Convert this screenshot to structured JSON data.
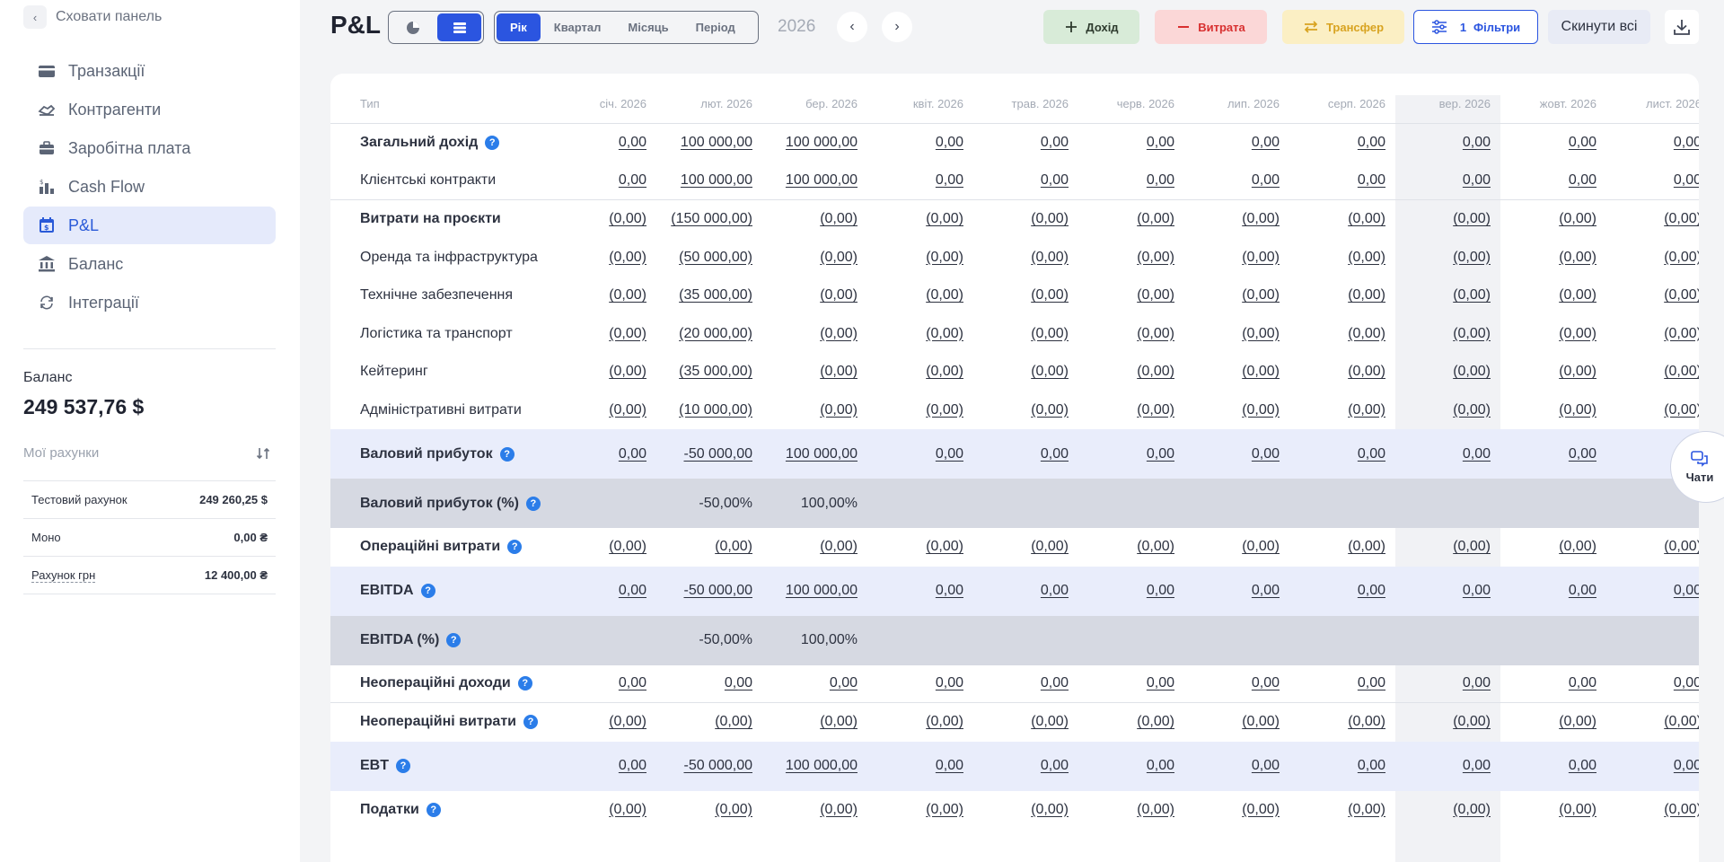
{
  "sidebar": {
    "collapse_label": "Сховати панель",
    "items": [
      {
        "label": "Транзакції",
        "icon": "card-icon"
      },
      {
        "label": "Контрагенти",
        "icon": "handshake-icon"
      },
      {
        "label": "Заробітна плата",
        "icon": "briefcase-icon"
      },
      {
        "label": "Cash Flow",
        "icon": "cashflow-icon"
      },
      {
        "label": "P&L",
        "icon": "calendar-dollar-icon",
        "active": true
      },
      {
        "label": "Баланс",
        "icon": "bank-icon"
      },
      {
        "label": "Інтеграції",
        "icon": "sync-icon"
      }
    ],
    "balance_label": "Баланс",
    "balance_value": "249 537,76 $",
    "accounts_label": "Мої рахунки",
    "accounts": [
      {
        "name": "Тестовий рахунок",
        "amount": "249 260,25 $"
      },
      {
        "name": "Моно",
        "amount": "0,00 ₴"
      },
      {
        "name": "Рахунок грн",
        "amount": "12 400,00 ₴"
      }
    ]
  },
  "toolbar": {
    "title": "P&L",
    "period_tabs": [
      "Рік",
      "Квартал",
      "Місяць",
      "Період"
    ],
    "active_period": "Рік",
    "year": "2026",
    "income_label": "Дохід",
    "expense_label": "Витрата",
    "transfer_label": "Трансфер",
    "filters_count": "1",
    "filters_label": "Фільтри",
    "reset_label": "Скинути всі"
  },
  "table": {
    "type_header": "Тип",
    "months": [
      "січ. 2026",
      "лют. 2026",
      "бер. 2026",
      "квіт. 2026",
      "трав. 2026",
      "черв. 2026",
      "лип. 2026",
      "серп. 2026",
      "вер. 2026",
      "жовт. 2026",
      "лист. 2026"
    ],
    "rows": [
      {
        "label": "Загальний дохід",
        "bold": true,
        "help": true,
        "values": [
          "0,00",
          "100 000,00",
          "100 000,00",
          "0,00",
          "0,00",
          "0,00",
          "0,00",
          "0,00",
          "0,00",
          "0,00",
          "0,00"
        ]
      },
      {
        "label": "Клієнтські контракти",
        "values": [
          "0,00",
          "100 000,00",
          "100 000,00",
          "0,00",
          "0,00",
          "0,00",
          "0,00",
          "0,00",
          "0,00",
          "0,00",
          "0,00"
        ],
        "line": true
      },
      {
        "label": "Витрати на проєкти",
        "bold": true,
        "values": [
          "(0,00)",
          "(150 000,00)",
          "(0,00)",
          "(0,00)",
          "(0,00)",
          "(0,00)",
          "(0,00)",
          "(0,00)",
          "(0,00)",
          "(0,00)",
          "(0,00)"
        ]
      },
      {
        "label": "Оренда та інфраструктура",
        "values": [
          "(0,00)",
          "(50 000,00)",
          "(0,00)",
          "(0,00)",
          "(0,00)",
          "(0,00)",
          "(0,00)",
          "(0,00)",
          "(0,00)",
          "(0,00)",
          "(0,00)"
        ]
      },
      {
        "label": "Технічне забезпечення",
        "values": [
          "(0,00)",
          "(35 000,00)",
          "(0,00)",
          "(0,00)",
          "(0,00)",
          "(0,00)",
          "(0,00)",
          "(0,00)",
          "(0,00)",
          "(0,00)",
          "(0,00)"
        ]
      },
      {
        "label": "Логістика та транспорт",
        "values": [
          "(0,00)",
          "(20 000,00)",
          "(0,00)",
          "(0,00)",
          "(0,00)",
          "(0,00)",
          "(0,00)",
          "(0,00)",
          "(0,00)",
          "(0,00)",
          "(0,00)"
        ]
      },
      {
        "label": "Кейтеринг",
        "values": [
          "(0,00)",
          "(35 000,00)",
          "(0,00)",
          "(0,00)",
          "(0,00)",
          "(0,00)",
          "(0,00)",
          "(0,00)",
          "(0,00)",
          "(0,00)",
          "(0,00)"
        ]
      },
      {
        "label": "Адміністративні витрати",
        "values": [
          "(0,00)",
          "(10 000,00)",
          "(0,00)",
          "(0,00)",
          "(0,00)",
          "(0,00)",
          "(0,00)",
          "(0,00)",
          "(0,00)",
          "(0,00)",
          "(0,00)"
        ]
      },
      {
        "label": "Валовий прибуток",
        "bold": true,
        "help": true,
        "shade": "blue",
        "values": [
          "0,00",
          "-50 000,00",
          "100 000,00",
          "0,00",
          "0,00",
          "0,00",
          "0,00",
          "0,00",
          "0,00",
          "0,00",
          ""
        ]
      },
      {
        "label": "Валовий прибуток (%)",
        "bold": true,
        "help": true,
        "shade": "gray",
        "plain": true,
        "values": [
          "",
          "-50,00%",
          "100,00%",
          "",
          "",
          "",
          "",
          "",
          "",
          "",
          ""
        ]
      },
      {
        "label": "Операційні витрати",
        "bold": true,
        "help": true,
        "values": [
          "(0,00)",
          "(0,00)",
          "(0,00)",
          "(0,00)",
          "(0,00)",
          "(0,00)",
          "(0,00)",
          "(0,00)",
          "(0,00)",
          "(0,00)",
          "(0,00)"
        ]
      },
      {
        "label": "EBITDA",
        "bold": true,
        "help": true,
        "shade": "blue",
        "values": [
          "0,00",
          "-50 000,00",
          "100 000,00",
          "0,00",
          "0,00",
          "0,00",
          "0,00",
          "0,00",
          "0,00",
          "0,00",
          "0,00"
        ]
      },
      {
        "label": "EBITDA (%)",
        "bold": true,
        "help": true,
        "shade": "gray",
        "plain": true,
        "values": [
          "",
          "-50,00%",
          "100,00%",
          "",
          "",
          "",
          "",
          "",
          "",
          "",
          ""
        ]
      },
      {
        "label": "Неопераційні доходи",
        "bold": true,
        "help": true,
        "values": [
          "0,00",
          "0,00",
          "0,00",
          "0,00",
          "0,00",
          "0,00",
          "0,00",
          "0,00",
          "0,00",
          "0,00",
          "0,00"
        ],
        "line": true
      },
      {
        "label": "Неопераційні витрати",
        "bold": true,
        "help": true,
        "values": [
          "(0,00)",
          "(0,00)",
          "(0,00)",
          "(0,00)",
          "(0,00)",
          "(0,00)",
          "(0,00)",
          "(0,00)",
          "(0,00)",
          "(0,00)",
          "(0,00)"
        ]
      },
      {
        "label": "EBT",
        "bold": true,
        "help": true,
        "shade": "blue",
        "values": [
          "0,00",
          "-50 000,00",
          "100 000,00",
          "0,00",
          "0,00",
          "0,00",
          "0,00",
          "0,00",
          "0,00",
          "0,00",
          "0,00"
        ]
      },
      {
        "label": "Податки",
        "bold": true,
        "help": true,
        "values": [
          "(0,00)",
          "(0,00)",
          "(0,00)",
          "(0,00)",
          "(0,00)",
          "(0,00)",
          "(0,00)",
          "(0,00)",
          "(0,00)",
          "(0,00)",
          "(0,00)"
        ]
      }
    ]
  },
  "chat": {
    "label": "Чати"
  }
}
